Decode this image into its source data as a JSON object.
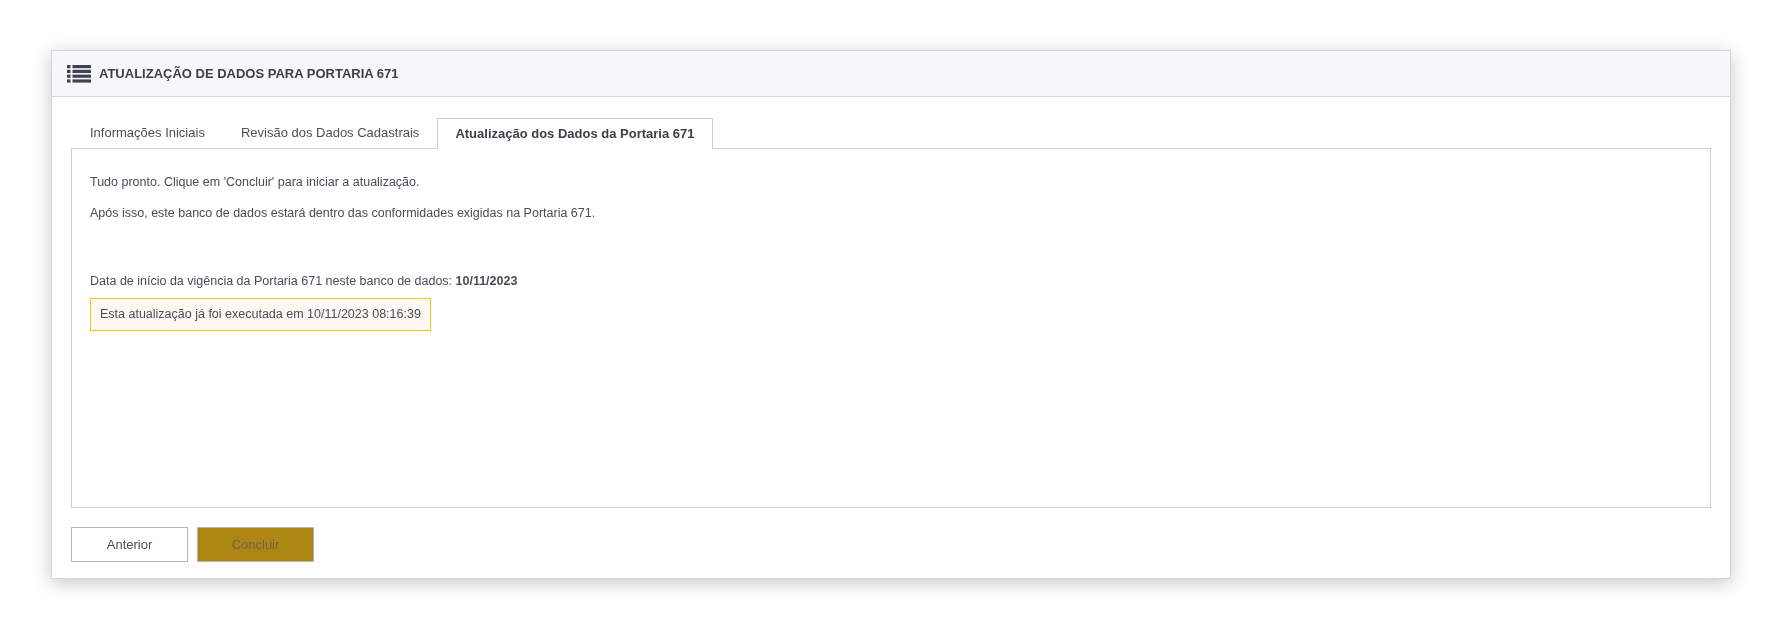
{
  "header": {
    "title": "ATUALIZAÇÃO DE DADOS PARA PORTARIA 671"
  },
  "tabs": [
    {
      "label": "Informações Iniciais",
      "selected": false
    },
    {
      "label": "Revisão dos Dados Cadastrais",
      "selected": false
    },
    {
      "label": "Atualização dos Dados da Portaria 671",
      "selected": true
    }
  ],
  "content": {
    "paragraphs": [
      "Tudo pronto. Clique em 'Concluir' para iniciar a atualização.",
      "Após isso, este banco de dados estará dentro das conformidades exigidas na Portaria 671."
    ],
    "start_date": "Data de início da vigência da Portaria 671 neste banco de dados: **10/11/2023**",
    "alert": "Esta atualização já foi executada em 10/11/2023 08:16:39"
  },
  "buttons": [
    {
      "label": "Anterior",
      "kind": "secondary",
      "disabled": false
    },
    {
      "label": "Concluir",
      "kind": "primary",
      "disabled": true
    }
  ]
}
